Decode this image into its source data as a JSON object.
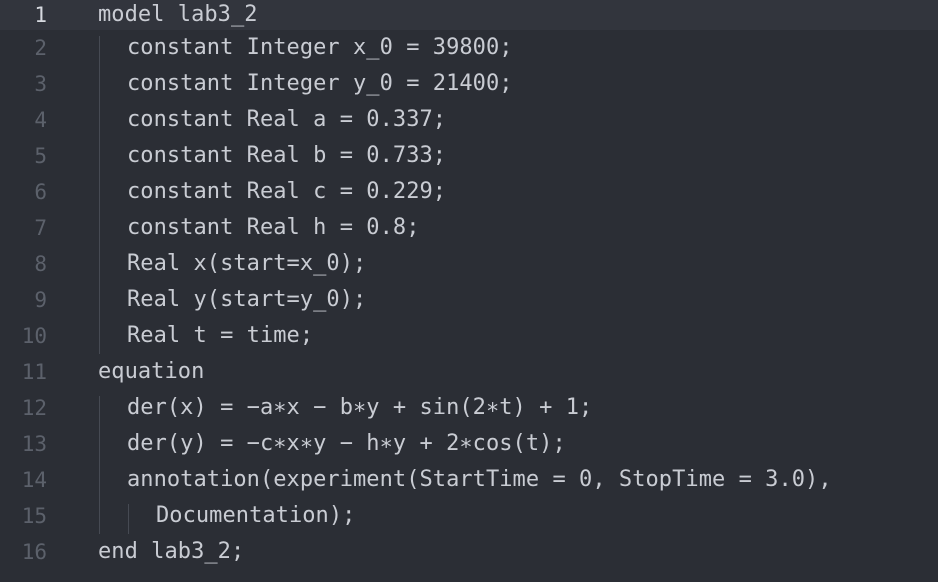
{
  "editor": {
    "lines": [
      {
        "number": "1",
        "text": "model lab3_2"
      },
      {
        "number": "2",
        "text": "constant Integer x_0 = 39800;"
      },
      {
        "number": "3",
        "text": "constant Integer y_0 = 21400;"
      },
      {
        "number": "4",
        "text": "constant Real a = 0.337;"
      },
      {
        "number": "5",
        "text": "constant Real b = 0.733;"
      },
      {
        "number": "6",
        "text": "constant Real c = 0.229;"
      },
      {
        "number": "7",
        "text": "constant Real h = 0.8;"
      },
      {
        "number": "8",
        "text": "Real x(start=x_0);"
      },
      {
        "number": "9",
        "text": "Real y(start=y_0);"
      },
      {
        "number": "10",
        "text": "Real t = time;"
      },
      {
        "number": "11",
        "text": "equation"
      },
      {
        "number": "12",
        "text": "der(x) = −a∗x − b∗y + sin(2∗t) + 1;"
      },
      {
        "number": "13",
        "text": "der(y) = −c∗x∗y − h∗y + 2∗cos(t);"
      },
      {
        "number": "14",
        "text": "annotation(experiment(StartTime = 0, StopTime = 3.0),"
      },
      {
        "number": "15",
        "text": "Documentation);"
      },
      {
        "number": "16",
        "text": "end lab3_2;"
      }
    ]
  },
  "colors": {
    "background": "#2b2e35",
    "current_line": "#32353d",
    "text": "#c9ccd3",
    "line_number": "#5c616b",
    "line_number_current": "#d7dae0"
  }
}
